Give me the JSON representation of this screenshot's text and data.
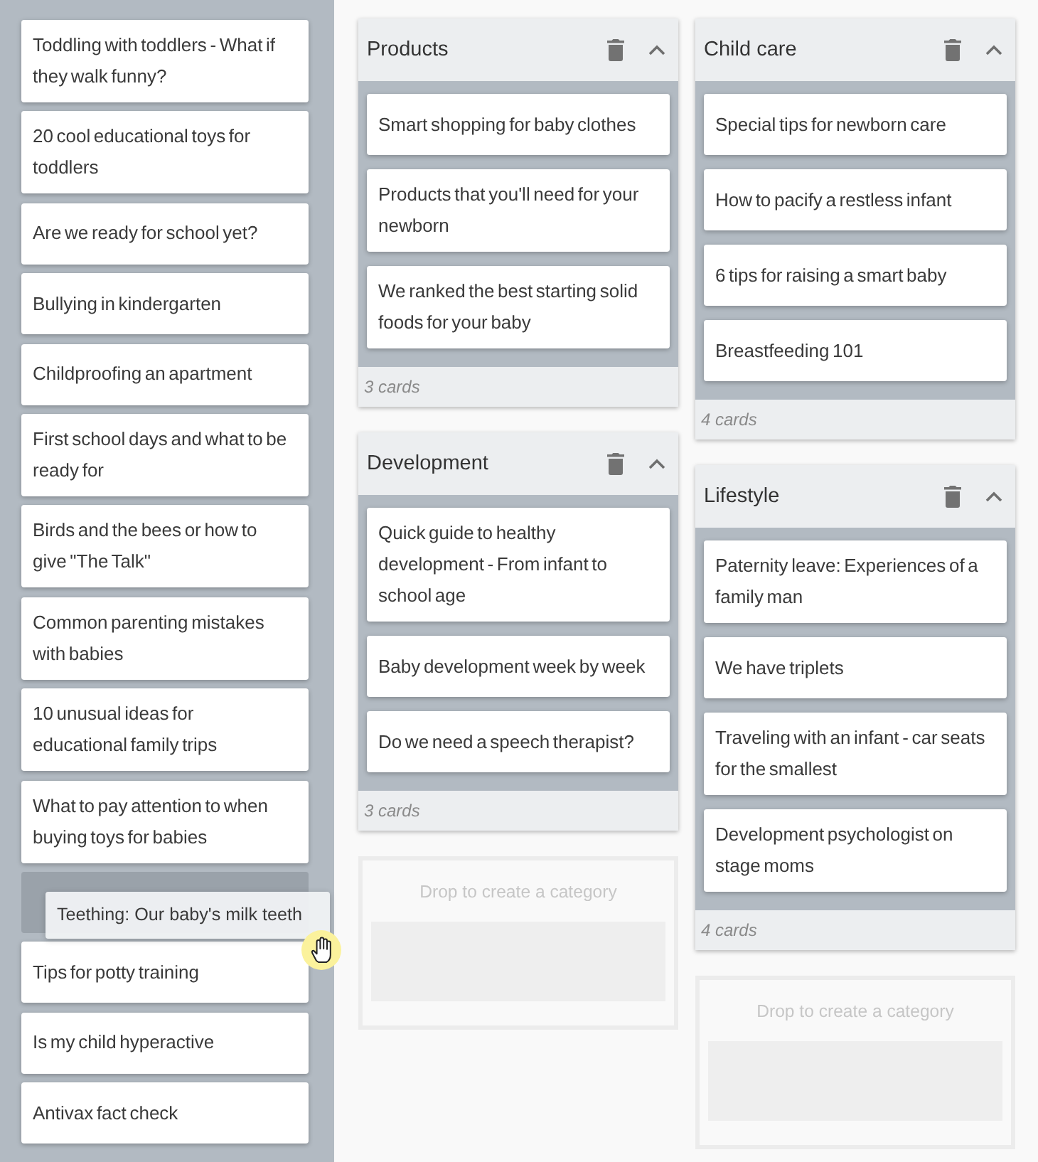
{
  "sidebar": {
    "items": [
      {
        "kind": "card",
        "text": "Toddling with toddlers - What if they walk funny?"
      },
      {
        "kind": "card",
        "text": "20 cool educational toys for toddlers"
      },
      {
        "kind": "card",
        "text": "Are we ready for school yet?"
      },
      {
        "kind": "card",
        "text": "Bullying in kindergarten"
      },
      {
        "kind": "card",
        "text": "Childproofing an apartment"
      },
      {
        "kind": "card",
        "text": "First school days and what to be ready for"
      },
      {
        "kind": "card",
        "text": "Birds and the bees or how to give \"The Talk\""
      },
      {
        "kind": "card",
        "text": "Common parenting mistakes with babies"
      },
      {
        "kind": "card",
        "text": "10 unusual ideas for educational family trips"
      },
      {
        "kind": "card",
        "text": "What to pay attention to when buying toys for babies"
      },
      {
        "kind": "drop_slot"
      },
      {
        "kind": "card",
        "text": "Tips for potty training"
      },
      {
        "kind": "card",
        "text": "Is my child hyperactive"
      },
      {
        "kind": "card",
        "text": "Antivax fact check"
      }
    ]
  },
  "drag_ghost": {
    "text": "Teething: Our baby's milk teeth"
  },
  "columns": [
    {
      "categories": [
        {
          "title": "Products",
          "expanded": true,
          "cards": [
            "Smart shopping for baby clothes",
            "Products that you'll need for your newborn",
            "We ranked the best starting solid foods for your baby"
          ],
          "count": "3 cards"
        },
        {
          "title": "Development",
          "expanded": true,
          "cards": [
            "Quick guide to healthy development - From infant to school age",
            "Baby development week by week",
            "Do we need a speech therapist?"
          ],
          "count": "3 cards"
        }
      ],
      "drop_zone": {
        "label": "Drop to create a category"
      }
    },
    {
      "categories": [
        {
          "title": "Child care",
          "expanded": true,
          "cards": [
            "Special tips for newborn care",
            "How to pacify a restless infant",
            "6 tips for raising a smart baby",
            "Breastfeeding 101"
          ],
          "count": "4 cards"
        },
        {
          "title": "Lifestyle",
          "expanded": true,
          "cards": [
            "Paternity leave: Experiences of a family man",
            "We have triplets",
            "Traveling with an infant - car seats for the smallest",
            "Development psychologist on stage moms"
          ],
          "count": "4 cards"
        }
      ],
      "drop_zone": {
        "label": "Drop to create a category"
      }
    }
  ]
}
